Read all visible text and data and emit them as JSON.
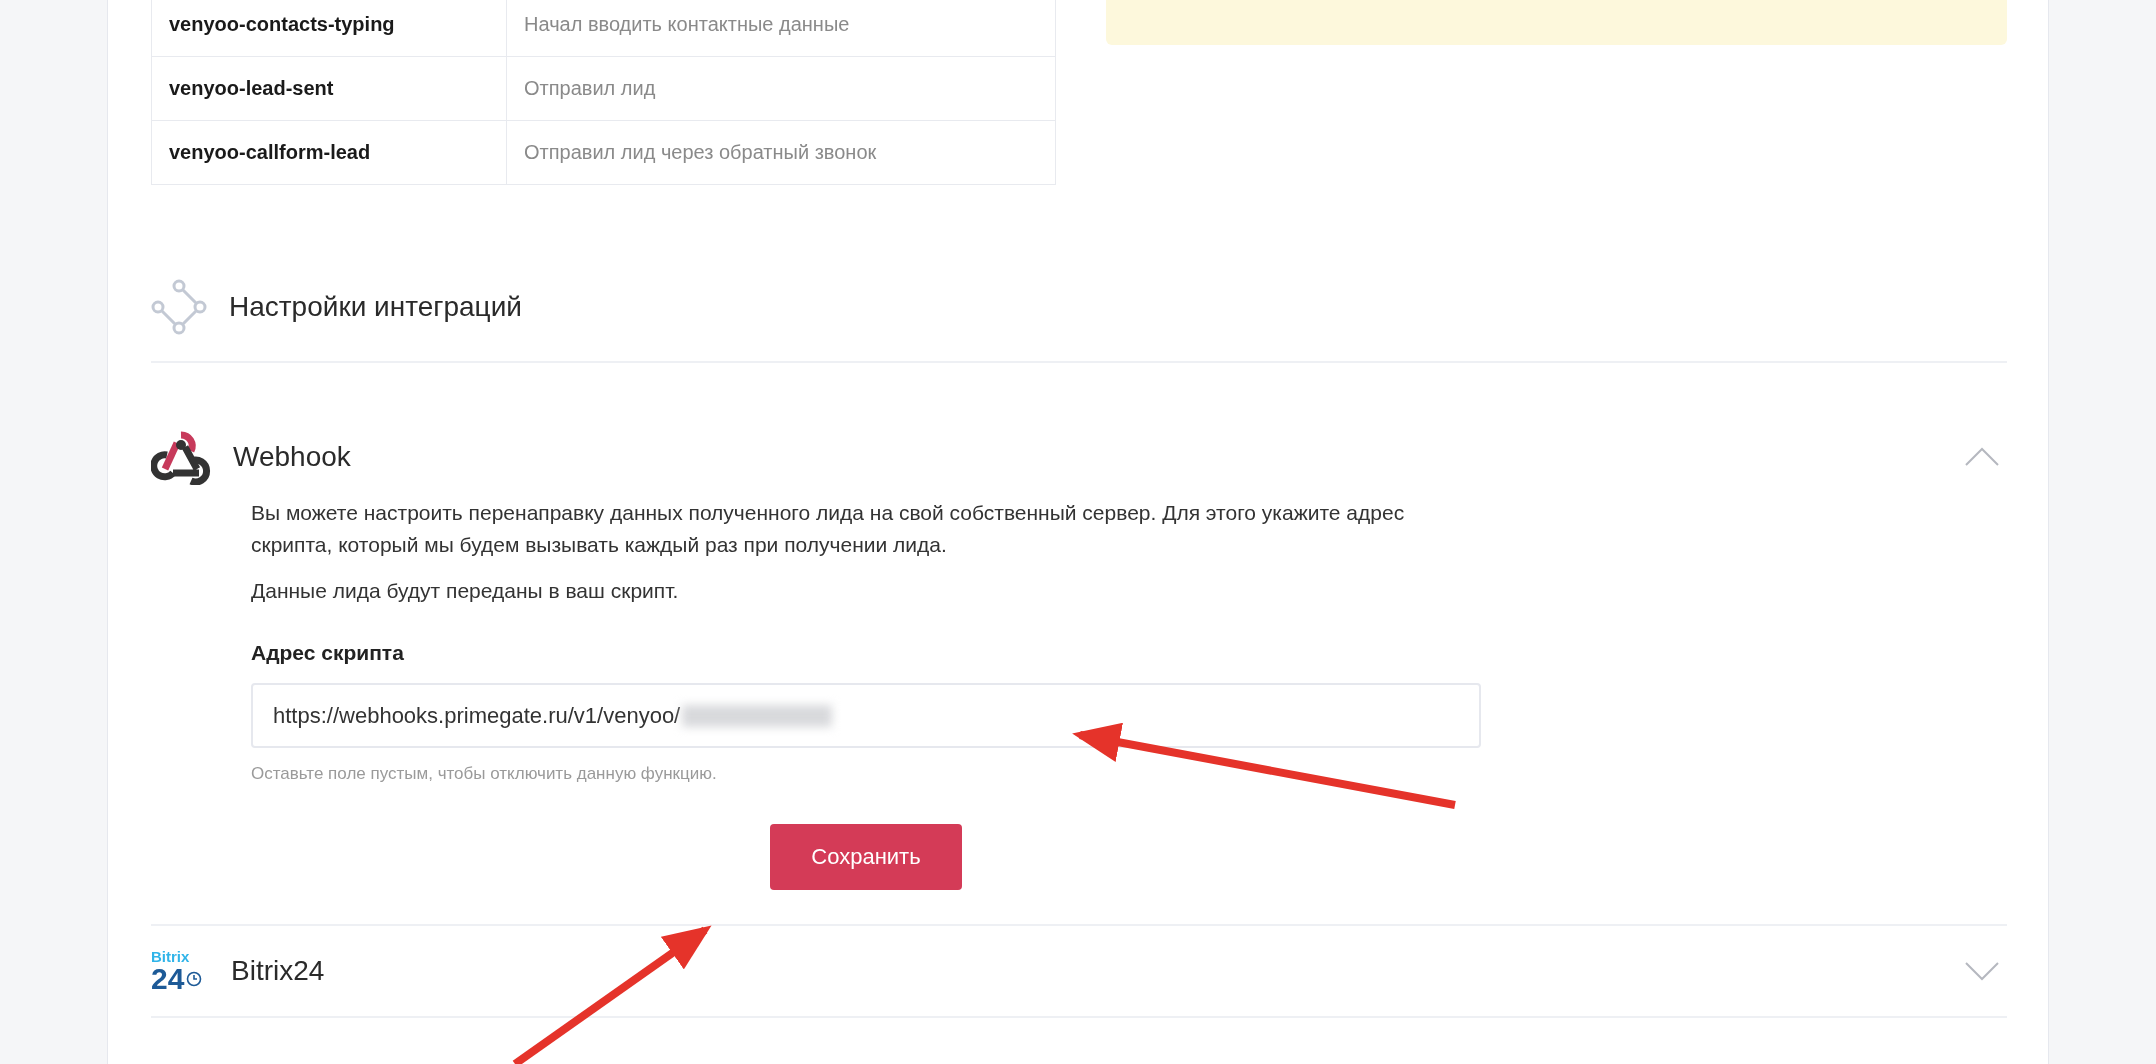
{
  "events_table": {
    "rows": [
      {
        "event": "venyoo-contacts-typing",
        "description": "Начал вводить контактные данные"
      },
      {
        "event": "venyoo-lead-sent",
        "description": "Отправил лид"
      },
      {
        "event": "venyoo-callform-lead",
        "description": "Отправил лид через обратный звонок"
      }
    ]
  },
  "section": {
    "title": "Настройки интеграций"
  },
  "integrations": [
    {
      "kind": "webhook",
      "name": "Webhook",
      "expanded": true,
      "paragraphs": [
        "Вы можете настроить перенаправку данных полученного лида на свой собственный сервер. Для этого укажите адрес скрипта, который мы будем вызывать каждый раз при получении лида.",
        "Данные лида будут переданы в ваш скрипт."
      ],
      "field": {
        "label": "Адрес скрипта",
        "value": "https://webhooks.primegate.ru/v1/venyoo/",
        "redacted": true,
        "hint": "Оставьте поле пустым, чтобы отключить данную функцию."
      },
      "button": "Сохранить"
    },
    {
      "kind": "bitrix",
      "name": "Bitrix24",
      "expanded": false,
      "logo_text": [
        "Bitrix",
        "24"
      ]
    }
  ]
}
